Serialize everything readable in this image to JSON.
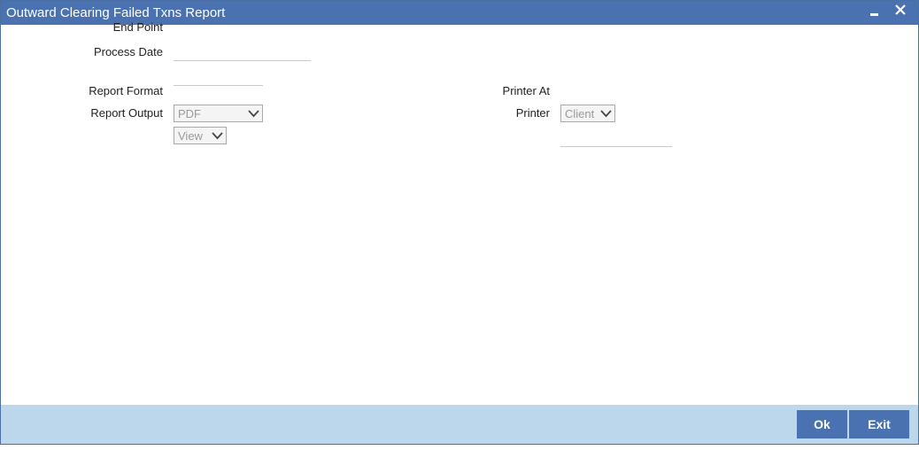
{
  "window": {
    "title": "Outward Clearing Failed Txns Report",
    "minimize_icon": "minimize-icon",
    "close_icon": "close-icon"
  },
  "form": {
    "end_point": {
      "label": "End Point",
      "value": ""
    },
    "process_date": {
      "label": "Process Date",
      "value": ""
    },
    "report_format": {
      "label": "Report Format",
      "selected": "PDF"
    },
    "report_output": {
      "label": "Report Output",
      "selected": "View"
    },
    "printer_at": {
      "label": "Printer At",
      "selected": "Client"
    },
    "printer": {
      "label": "Printer",
      "value": ""
    }
  },
  "footer": {
    "ok_label": "Ok",
    "exit_label": "Exit"
  },
  "colors": {
    "titlebar": "#4a72b0",
    "footer": "#bcd7ec",
    "button": "#4a72b0"
  }
}
